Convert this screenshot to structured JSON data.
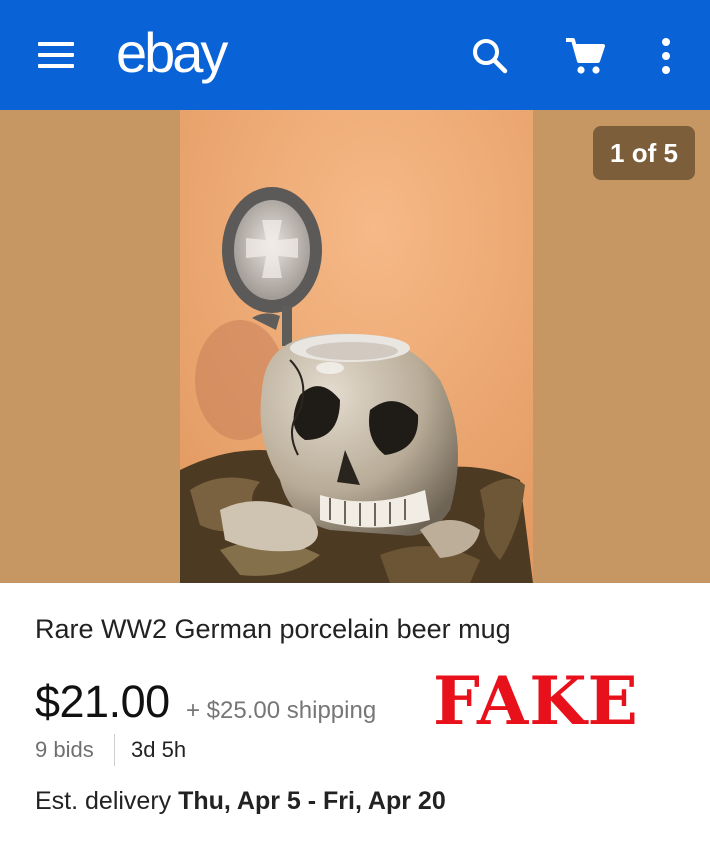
{
  "header": {
    "logo": "ebay",
    "icons": [
      "menu-icon",
      "search-icon",
      "cart-icon",
      "more-vertical-icon"
    ],
    "background": "#0a63d6"
  },
  "gallery": {
    "counter": "1 of 5",
    "image_subject": "porcelain skull beer mug with lid"
  },
  "listing": {
    "title": "Rare WW2 German porcelain beer mug",
    "price": "$21.00",
    "shipping": "+ $25.00 shipping",
    "stamp": "FAKE",
    "bids": "9 bids",
    "time_left": "3d 5h",
    "delivery_label": "Est. delivery",
    "delivery_dates": "Thu, Apr 5 - Fri, Apr 20"
  },
  "colors": {
    "stamp": "#e8101a",
    "secondary_text": "#767676"
  }
}
